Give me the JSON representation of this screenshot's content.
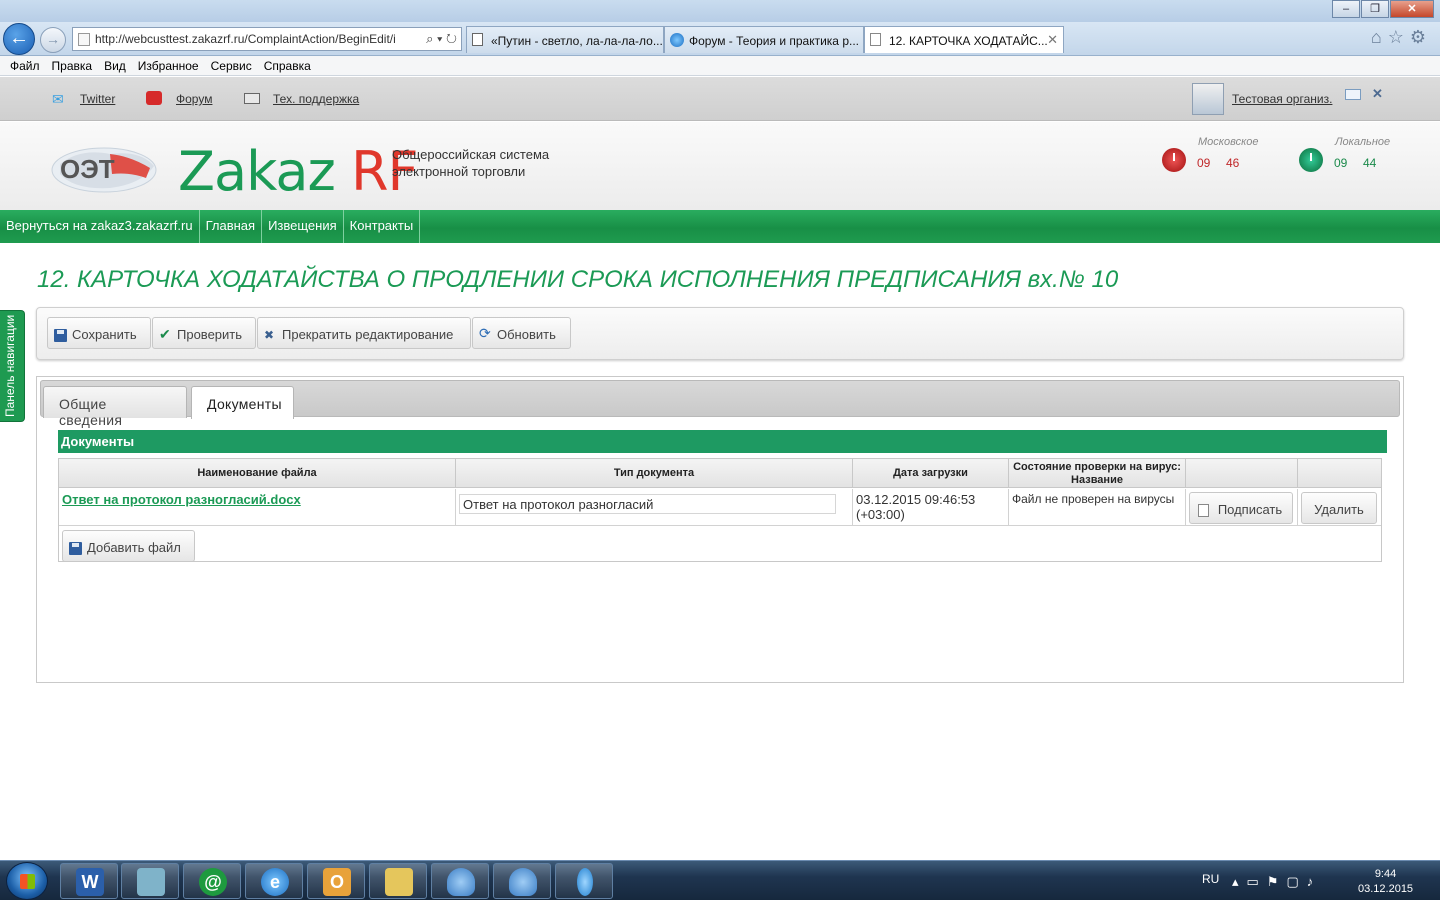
{
  "browser": {
    "address": "http://webcusttest.zakazrf.ru/ComplaintAction/BeginEdit/i",
    "tabs": [
      {
        "label": "«Путин - светло, ла-ла-ла-ло..."
      },
      {
        "label": "Форум - Теория и практика р..."
      },
      {
        "label": "12. КАРТОЧКА ХОДАТАЙС..."
      }
    ],
    "menu": [
      "Файл",
      "Правка",
      "Вид",
      "Избранное",
      "Сервис",
      "Справка"
    ]
  },
  "topstrip": {
    "links": [
      "Twitter",
      "Форум",
      "Тех. поддержка"
    ],
    "org": "Тестовая организ."
  },
  "header": {
    "logo_main": "Zakaz",
    "logo_rf": "RF",
    "logo_mark": "ОЭТ",
    "subtitle_line1": "Общероссийская система",
    "subtitle_line2": "электронной торговли",
    "clock_moscow": {
      "label": "Московское",
      "hours": "09",
      "minutes": "46"
    },
    "clock_local": {
      "label": "Локальное",
      "hours": "09",
      "minutes": "44"
    }
  },
  "nav": [
    "Вернуться на zakaz3.zakazrf.ru",
    "Главная",
    "Извещения",
    "Контракты"
  ],
  "side_panel": "Панель навигации",
  "page": {
    "title": "12. КАРТОЧКА ХОДАТАЙСТВА О ПРОДЛЕНИИ СРОКА ИСПОЛНЕНИЯ ПРЕДПИСАНИЯ вх.№ 10",
    "toolbar": {
      "save": "Сохранить",
      "check": "Проверить",
      "stop_edit": "Прекратить редактирование",
      "refresh": "Обновить"
    },
    "tabs": [
      "Общие сведения",
      "Документы"
    ],
    "active_tab": "Документы",
    "docs": {
      "header": "Документы",
      "columns": [
        "Наименование файла",
        "Тип документа",
        "Дата загрузки",
        "Состояние проверки на вирус: Название",
        "",
        ""
      ],
      "rows": [
        {
          "file": "Ответ на протокол разногласий.docx",
          "type": "Ответ на протокол разногласий",
          "date_line1": "03.12.2015 09:46:53",
          "date_line2": "(+03:00)",
          "virus_status": "Файл не проверен на вирусы",
          "sign": "Подписать",
          "delete": "Удалить"
        }
      ],
      "add_file": "Добавить файл"
    }
  },
  "taskbar": {
    "lang": "RU",
    "time": "9:44",
    "date": "03.12.2015",
    "apps": [
      "word-icon",
      "notebook-icon",
      "mail-agent-icon",
      "ie-icon",
      "outlook-icon",
      "explorer-icon",
      "user-icon",
      "user-icon",
      "skype-icon"
    ]
  }
}
